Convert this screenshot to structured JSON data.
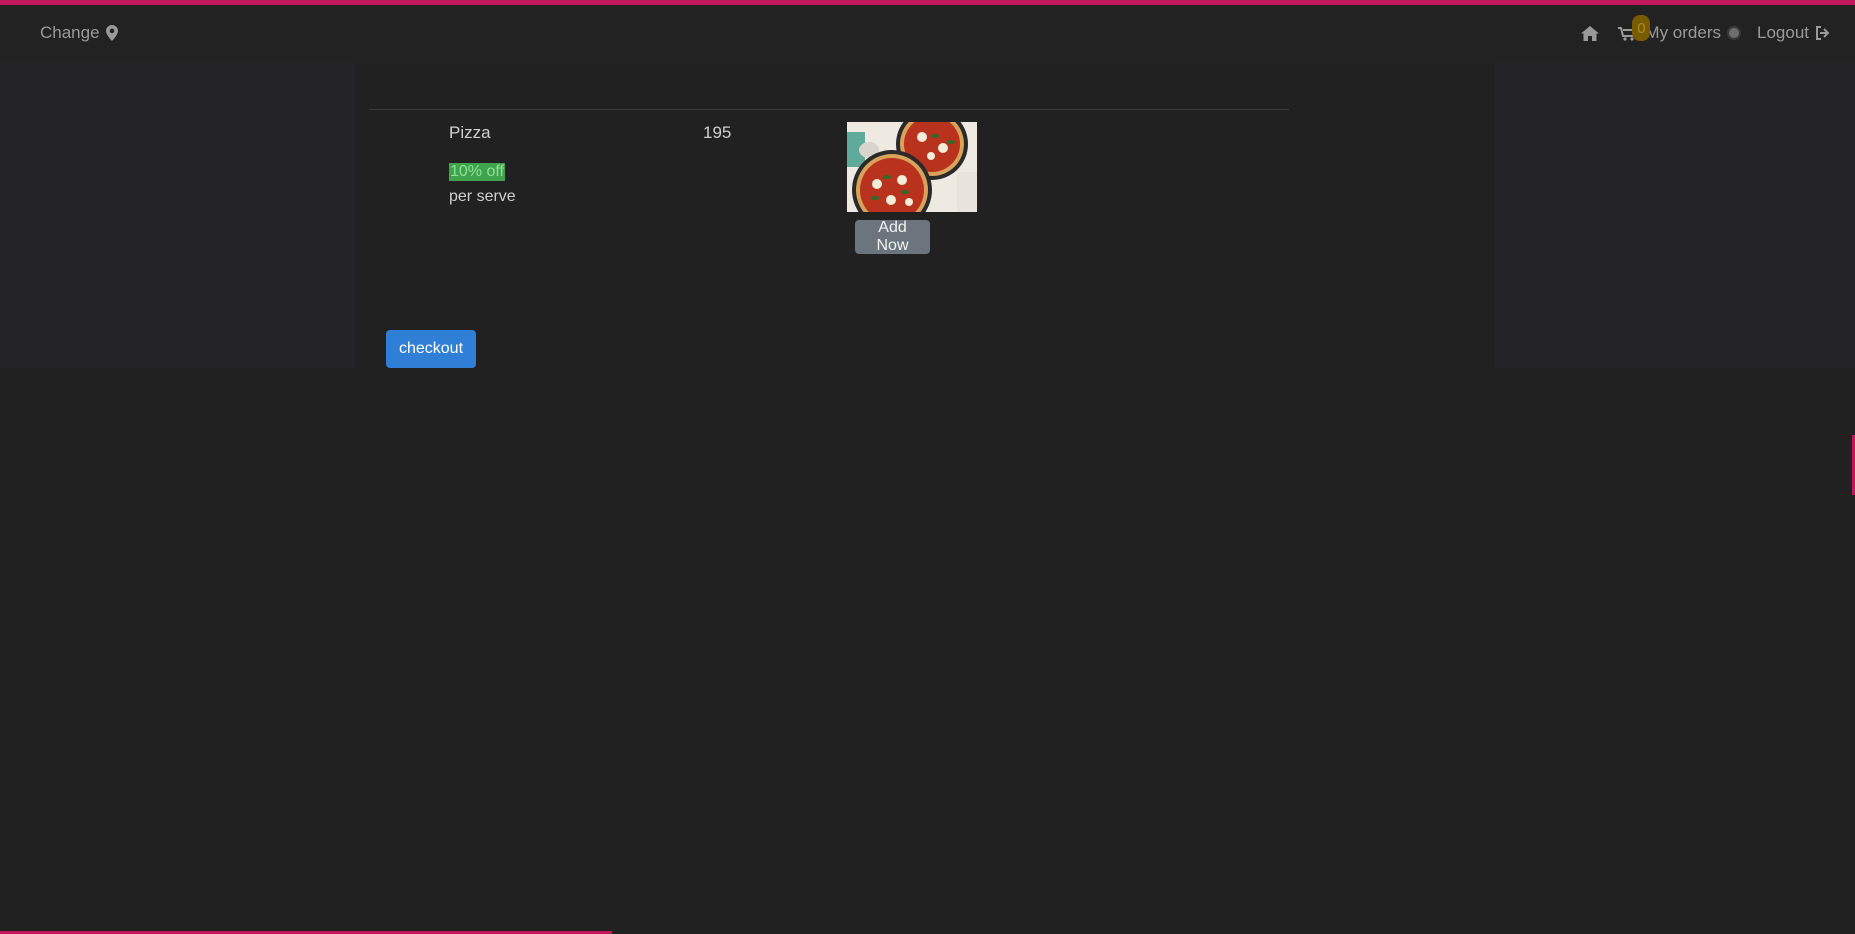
{
  "navbar": {
    "change_label": "Change",
    "cart_count": "0",
    "my_orders_label": "My orders",
    "logout_label": "Logout",
    "accent_color": "#c2185b"
  },
  "product": {
    "name": "Pizza",
    "discount": "10% off",
    "unit": "per serve",
    "price": "195",
    "add_button_label": "Add Now",
    "image_icon": "pizza-image"
  },
  "checkout": {
    "label": "checkout",
    "color": "#2f7fd6"
  }
}
